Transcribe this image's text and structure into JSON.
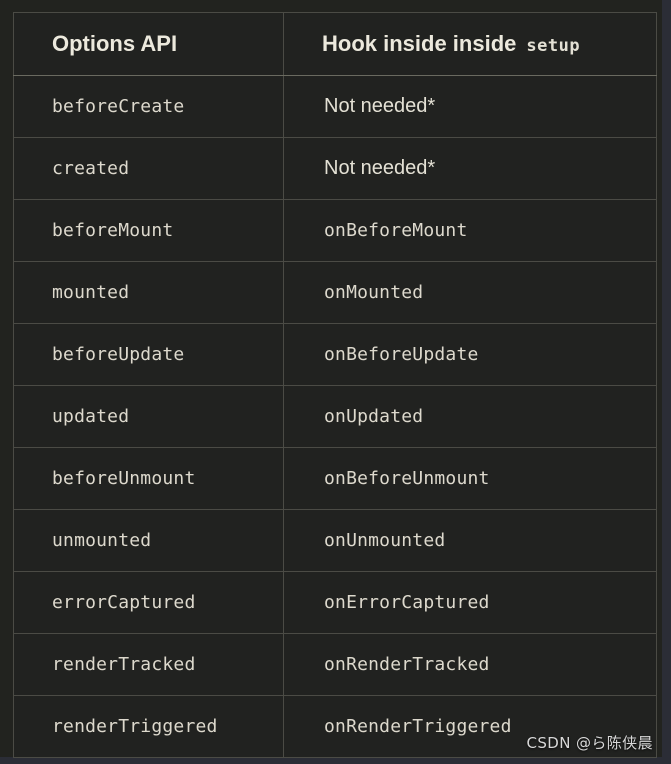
{
  "table": {
    "headers": {
      "col1": "Options API",
      "col2_text": "Hook inside inside",
      "col2_code": "setup"
    },
    "rows": [
      {
        "option": "beforeCreate",
        "hook": "Not needed*",
        "hook_style": "sans"
      },
      {
        "option": "created",
        "hook": "Not needed*",
        "hook_style": "sans"
      },
      {
        "option": "beforeMount",
        "hook": "onBeforeMount",
        "hook_style": "mono"
      },
      {
        "option": "mounted",
        "hook": "onMounted",
        "hook_style": "mono"
      },
      {
        "option": "beforeUpdate",
        "hook": "onBeforeUpdate",
        "hook_style": "mono"
      },
      {
        "option": "updated",
        "hook": "onUpdated",
        "hook_style": "mono"
      },
      {
        "option": "beforeUnmount",
        "hook": "onBeforeUnmount",
        "hook_style": "mono"
      },
      {
        "option": "unmounted",
        "hook": "onUnmounted",
        "hook_style": "mono"
      },
      {
        "option": "errorCaptured",
        "hook": "onErrorCaptured",
        "hook_style": "mono"
      },
      {
        "option": "renderTracked",
        "hook": "onRenderTracked",
        "hook_style": "mono"
      },
      {
        "option": "renderTriggered",
        "hook": "onRenderTriggered",
        "hook_style": "mono"
      }
    ]
  },
  "watermark": {
    "text": "CSDN @ら陈侠晨"
  },
  "colors": {
    "page_background": "#22231f",
    "gutter": "#2b2d36",
    "cell_background": "#212220",
    "border": "#4b4b45",
    "header_border": "#6a6a60",
    "text": "#ddd9cd",
    "header_text": "#ece9dd"
  }
}
